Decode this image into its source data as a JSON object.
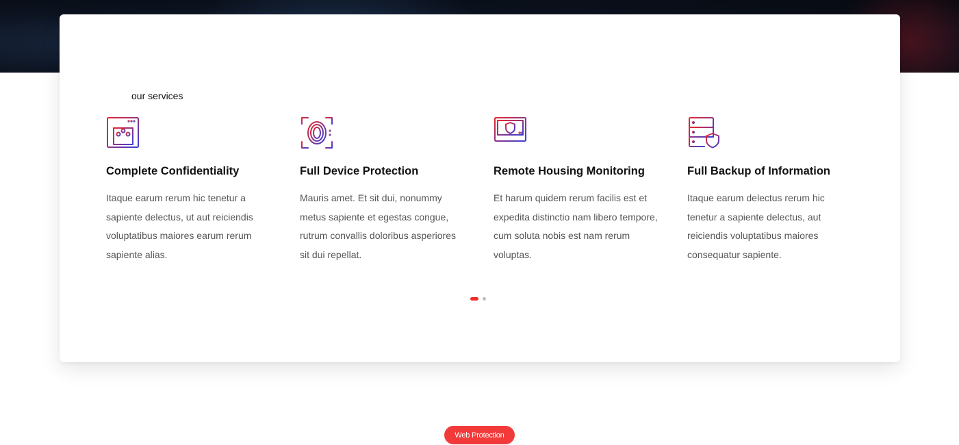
{
  "services_section": {
    "eyebrow": "our services",
    "items": [
      {
        "icon": "browser-circuit-icon",
        "title": "Complete Confidentiality",
        "description": "Itaque earum rerum hic tenetur a sapiente delectus, ut aut reiciendis voluptatibus maiores earum rerum sapiente alias."
      },
      {
        "icon": "fingerprint-scan-icon",
        "title": "Full Device Protection",
        "description": "Mauris amet. Et sit dui, nonummy metus sapiente et egestas congue, rutrum convallis doloribus asperiores sit dui repellat."
      },
      {
        "icon": "monitor-shield-icon",
        "title": "Remote Housing Monitoring",
        "description": "Et harum quidem rerum facilis est et expedita distinctio nam libero tempore, cum soluta nobis est nam rerum voluptas."
      },
      {
        "icon": "server-shield-icon",
        "title": "Full Backup of Information",
        "description": "Itaque earum delectus rerum hic tenetur a sapiente delectus, aut reiciendis voluptatibus maiores consequatur sapiente."
      }
    ],
    "carousel": {
      "pages": 2,
      "active_page": 1
    }
  },
  "badge": {
    "label": "Web Protection"
  },
  "colors": {
    "accent_red": "#f23a3a",
    "icon_gradient_start": "#e8262f",
    "icon_gradient_end": "#3b3fd6",
    "hero_dark": "#0c1320"
  }
}
